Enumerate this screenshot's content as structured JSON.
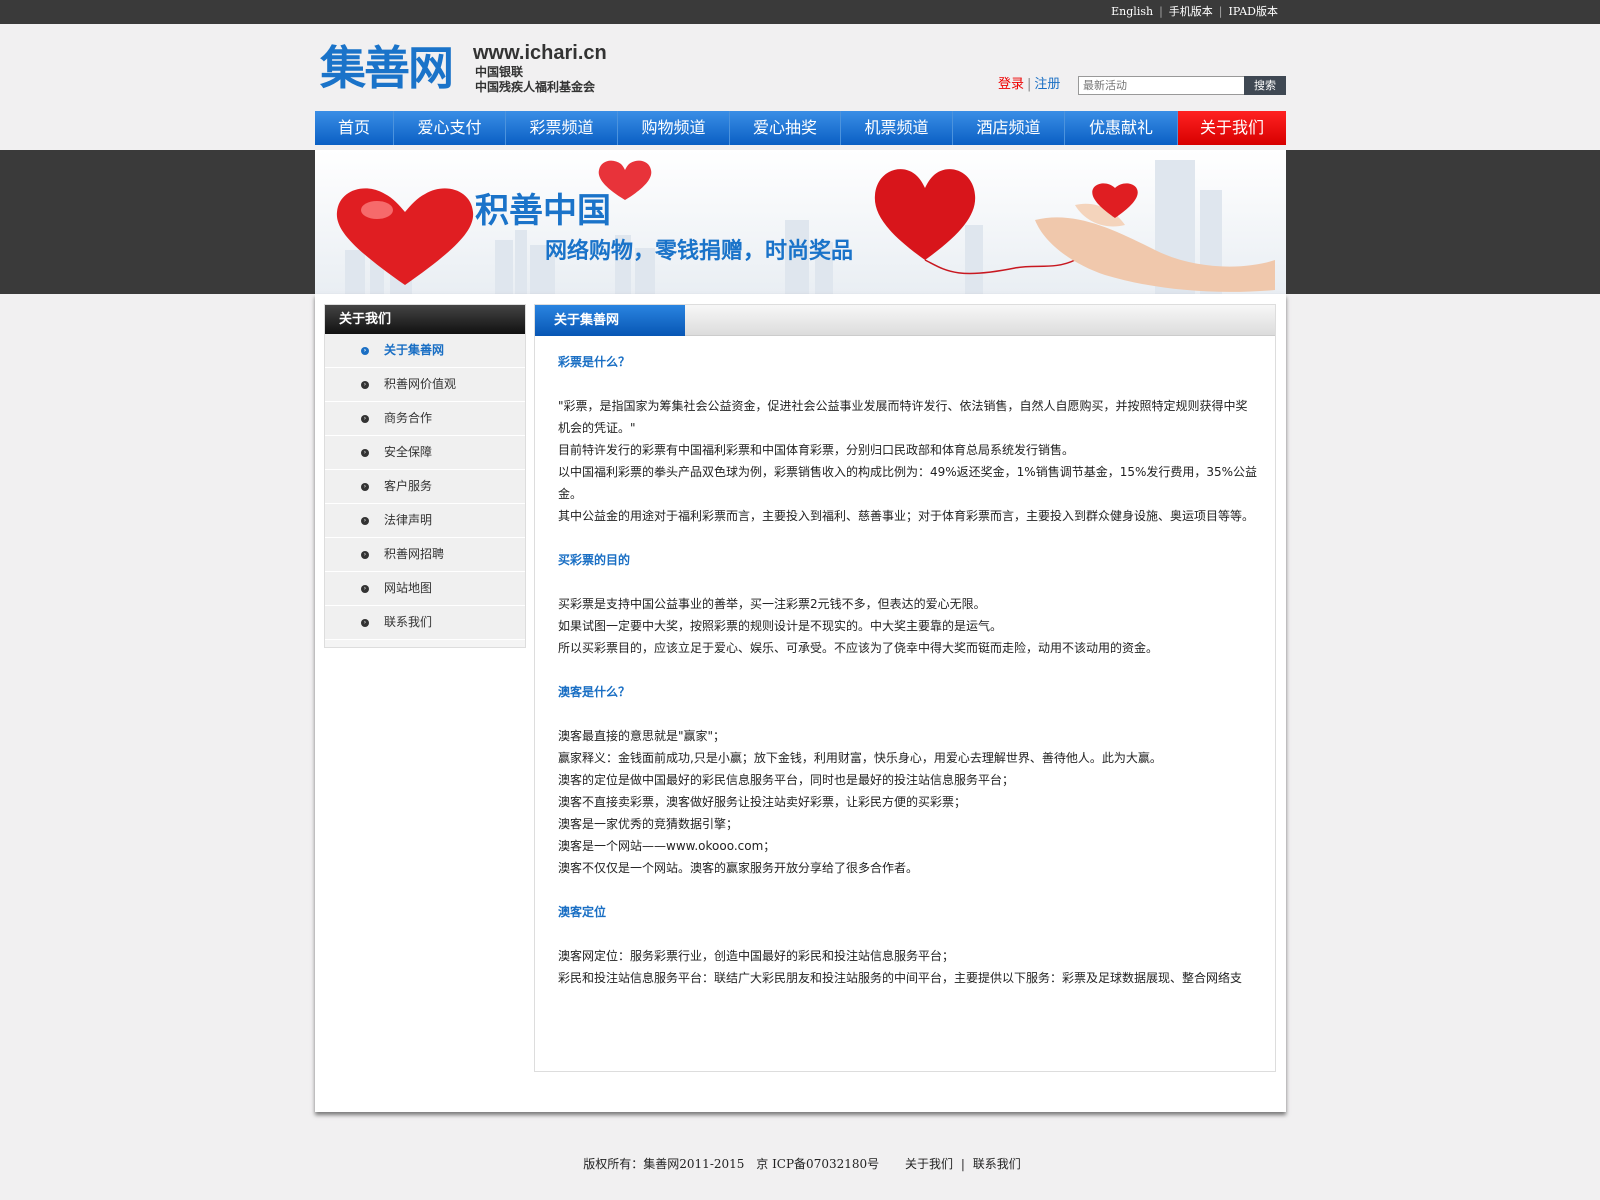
{
  "top_links": [
    "English",
    "手机版本",
    "IPAD版本"
  ],
  "logo": {
    "name": "集善网",
    "url": "www.ichari.cn",
    "sub1": "中国银联",
    "sub2": "中国残疾人福利基金会"
  },
  "auth": {
    "login": "登录",
    "register": "注册"
  },
  "search": {
    "placeholder": "最新活动",
    "button": "搜索"
  },
  "nav": [
    "首页",
    "爱心支付",
    "彩票频道",
    "购物频道",
    "爱心抽奖",
    "机票频道",
    "酒店频道",
    "优惠献礼",
    "关于我们"
  ],
  "nav_active_index": 8,
  "banner": {
    "title": "积善中国",
    "slogan": "网络购物，零钱捐赠，时尚奖品"
  },
  "sidebar": {
    "title": "关于我们",
    "items": [
      "关于集善网",
      "积善网价值观",
      "商务合作",
      "安全保障",
      "客户服务",
      "法律声明",
      "积善网招聘",
      "网站地图",
      "联系我们"
    ],
    "active_index": 0
  },
  "content": {
    "title": "关于集善网",
    "sections": [
      {
        "heading": "彩票是什么？",
        "paragraphs": [
          "\"彩票，是指国家为筹集社会公益资金，促进社会公益事业发展而特许发行、依法销售，自然人自愿购买，并按照特定规则获得中奖机会的凭证。\"",
          "目前特许发行的彩票有中国福利彩票和中国体育彩票，分别归口民政部和体育总局系统发行销售。",
          "以中国福利彩票的拳头产品双色球为例，彩票销售收入的构成比例为：49%返还奖金，1%销售调节基金，15%发行费用，35%公益金。",
          "其中公益金的用途对于福利彩票而言，主要投入到福利、慈善事业；对于体育彩票而言，主要投入到群众健身设施、奥运项目等等。"
        ]
      },
      {
        "heading": "买彩票的目的",
        "paragraphs": [
          "买彩票是支持中国公益事业的善举，买一注彩票2元钱不多，但表达的爱心无限。",
          "如果试图一定要中大奖，按照彩票的规则设计是不现实的。中大奖主要靠的是运气。",
          "所以买彩票目的，应该立足于爱心、娱乐、可承受。不应该为了侥幸中得大奖而铤而走险，动用不该动用的资金。"
        ]
      },
      {
        "heading": "澳客是什么？",
        "paragraphs": [
          "澳客最直接的意思就是\"赢家\"；",
          "赢家释义：金钱面前成功,只是小赢；放下金钱，利用财富，快乐身心，用爱心去理解世界、善待他人。此为大赢。",
          "澳客的定位是做中国最好的彩民信息服务平台，同时也是最好的投注站信息服务平台；",
          "澳客不直接卖彩票，澳客做好服务让投注站卖好彩票，让彩民方便的买彩票；",
          "澳客是一家优秀的竞猜数据引擎；",
          "澳客是一个网站——www.okooo.com；",
          "澳客不仅仅是一个网站。澳客的赢家服务开放分享给了很多合作者。"
        ]
      },
      {
        "heading": "澳客定位",
        "paragraphs": [
          "澳客网定位：服务彩票行业，创造中国最好的彩民和投注站信息服务平台；",
          "彩民和投注站信息服务平台：联结广大彩民朋友和投注站服务的中间平台，主要提供以下服务：彩票及足球数据展现、整合网络支"
        ]
      }
    ]
  },
  "footer": {
    "copyright": "版权所有：集善网2011-2015",
    "icp": "京 ICP备07032180号",
    "links": [
      "关于我们",
      "联系我们"
    ]
  },
  "colors": {
    "brand_blue": "#1a6fc4",
    "active_red": "#e00000",
    "topbar": "#3a3a3a"
  }
}
